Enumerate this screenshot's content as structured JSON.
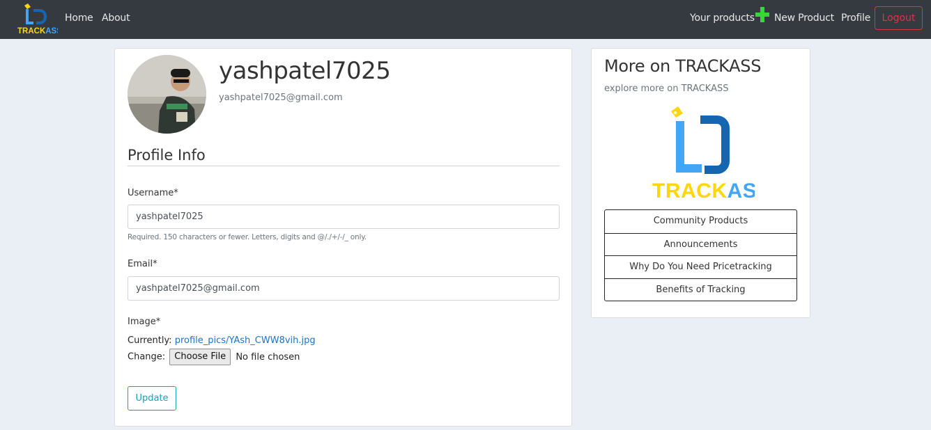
{
  "brand": {
    "logo_text_a": "TRACK",
    "logo_text_b": "ASS"
  },
  "nav": {
    "home": "Home",
    "about": "About",
    "your_products": "Your products",
    "new_product": "New Product",
    "profile": "Profile",
    "logout": "Logout"
  },
  "profile": {
    "username": "yashpatel7025",
    "email": "yashpatel7025@gmail.com"
  },
  "form": {
    "section_title": "Profile Info",
    "username_label": "Username*",
    "username_value": "yashpatel7025",
    "username_help": "Required. 150 characters or fewer. Letters, digits and @/./+/-/_ only.",
    "email_label": "Email*",
    "email_value": "yashpatel7025@gmail.com",
    "image_label": "Image*",
    "currently_label": "Currently:",
    "current_file": "profile_pics/YAsh_CWW8vih.jpg",
    "change_label": "Change:",
    "choose_file": "Choose File",
    "no_file": "No file chosen",
    "update_button": "Update"
  },
  "sidebar": {
    "title": "More on TRACKASS",
    "subtitle": "explore more on TRACKASS",
    "items": [
      {
        "label": "Community Products"
      },
      {
        "label": "Announcements"
      },
      {
        "label": "Why Do You Need Pricetracking"
      },
      {
        "label": "Benefits of Tracking"
      }
    ]
  },
  "colors": {
    "navbar_bg": "#343a40",
    "page_bg": "#eaeff5",
    "logo_blue_dark": "#1565b0",
    "logo_blue_light": "#42a5f5",
    "logo_yellow": "#ffd60a",
    "plus_green": "#3cd33c",
    "logout_red": "#dc3545",
    "update_teal": "#17a2b8"
  },
  "icons": {
    "new_product": "plus-icon",
    "brand": "trackass-logo"
  }
}
